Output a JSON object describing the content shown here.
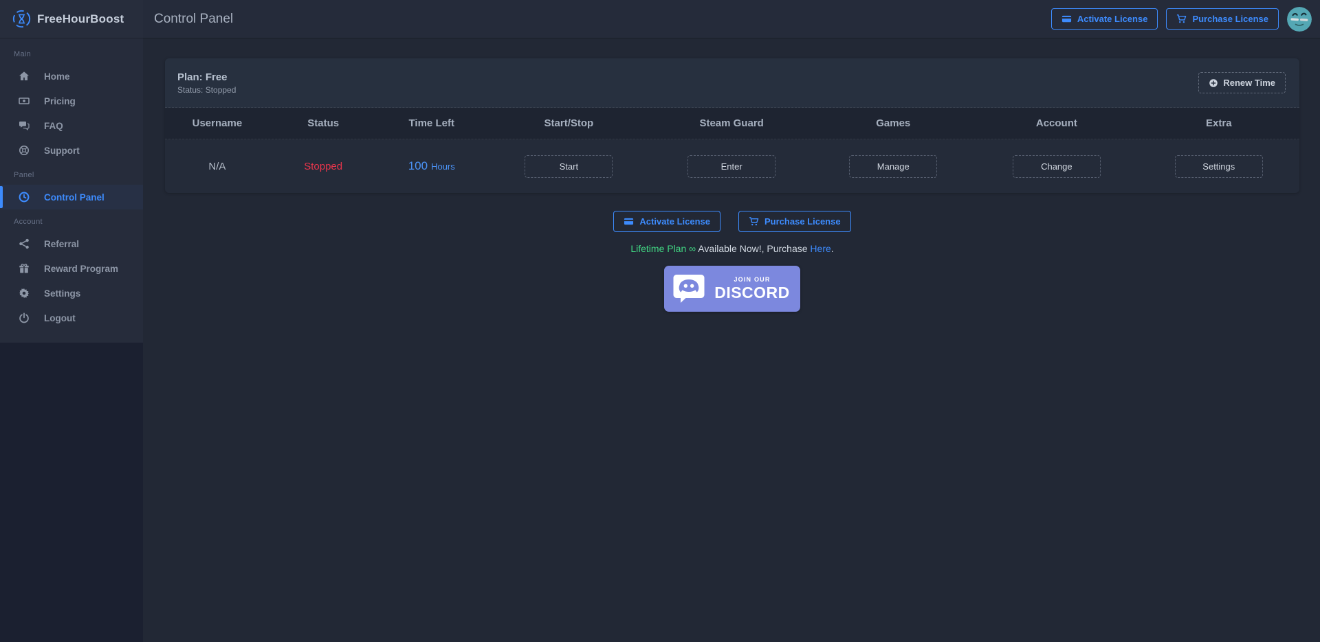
{
  "brand": {
    "name": "FreeHourBoost",
    "logo_icon": "hourglass-boost-icon"
  },
  "header": {
    "title": "Control Panel",
    "actions": [
      {
        "label": "Activate License",
        "icon": "credit-card-icon"
      },
      {
        "label": "Purchase License",
        "icon": "cart-icon"
      }
    ]
  },
  "sidebar": {
    "sections": [
      {
        "label": "Main",
        "items": [
          {
            "label": "Home",
            "icon": "home-icon",
            "active": false
          },
          {
            "label": "Pricing",
            "icon": "money-icon",
            "active": false
          },
          {
            "label": "FAQ",
            "icon": "comments-icon",
            "active": false
          },
          {
            "label": "Support",
            "icon": "life-ring-icon",
            "active": false
          }
        ]
      },
      {
        "label": "Panel",
        "items": [
          {
            "label": "Control Panel",
            "icon": "clock-icon",
            "active": true
          }
        ]
      },
      {
        "label": "Account",
        "items": [
          {
            "label": "Referral",
            "icon": "share-icon",
            "active": false
          },
          {
            "label": "Reward Program",
            "icon": "gift-icon",
            "active": false
          },
          {
            "label": "Settings",
            "icon": "gear-icon",
            "active": false
          },
          {
            "label": "Logout",
            "icon": "power-icon",
            "active": false
          }
        ]
      }
    ]
  },
  "panel": {
    "plan_label": "Plan: Free",
    "status_label": "Status: Stopped",
    "renew_button": {
      "label": "Renew Time",
      "icon": "plus-circle-icon"
    },
    "table": {
      "columns": [
        "Username",
        "Status",
        "Time Left",
        "Start/Stop",
        "Steam Guard",
        "Games",
        "Account",
        "Extra"
      ],
      "row": {
        "username": "N/A",
        "status": "Stopped",
        "time_left_value": "100",
        "time_left_unit": "Hours",
        "buttons": [
          "Start",
          "Enter",
          "Manage",
          "Change",
          "Settings"
        ]
      }
    }
  },
  "license_buttons": [
    {
      "label": "Activate License",
      "icon": "credit-card-icon"
    },
    {
      "label": "Purchase License",
      "icon": "cart-icon"
    }
  ],
  "promo": {
    "plan": "Lifetime Plan",
    "infinity": "∞",
    "middle": " Available Now!, Purchase ",
    "link": "Here",
    "suffix": "."
  },
  "discord": {
    "top_text": "JOIN OUR",
    "bottom_text": "DISCORD"
  },
  "colors": {
    "accent": "#3d8bfd",
    "danger": "#e8354b",
    "success": "#41d783",
    "discord_blurple": "#7c88de",
    "avatar_teal": "#54a7b4"
  }
}
